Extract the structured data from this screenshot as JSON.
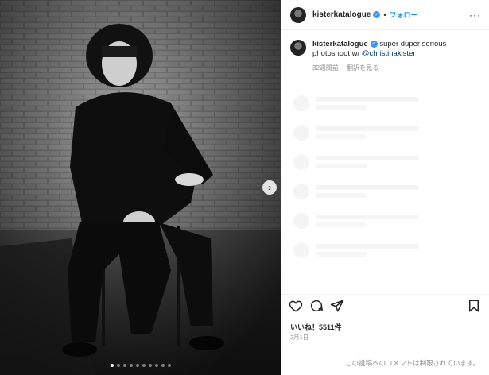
{
  "post": {
    "username": "kisterkatalogue",
    "follow_label": "フォロー",
    "separator": "•",
    "more_label": "···",
    "caption_text": "super duper serious photoshoot w/ ",
    "caption_mention": "@christinakister",
    "posted_ago": "32週間前",
    "translate_label": "翻訳を見る",
    "likes": "いいね！5511件",
    "date": "2月1日",
    "comments_restricted": "この投稿へのコメントは制限されています。"
  },
  "carousel": {
    "slide_count": 10,
    "active_slide": 1,
    "next_glyph": "›"
  },
  "icons": [
    "heart-icon",
    "comment-icon",
    "share-icon",
    "bookmark-icon",
    "verified-icon"
  ],
  "colors": {
    "accent": "#0095f6",
    "verified": "#3897f0",
    "muted": "#8e8e8e",
    "text": "#262626"
  }
}
